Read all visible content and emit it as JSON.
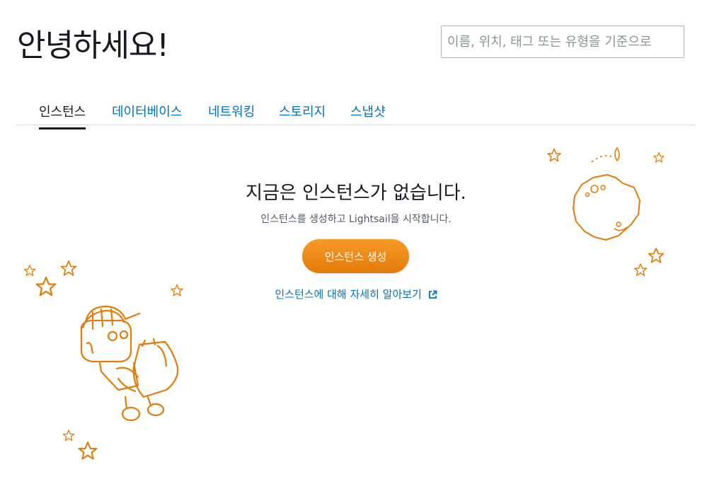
{
  "header": {
    "greeting": "안녕하세요!",
    "search_placeholder": "이름, 위치, 태그 또는 유형을 기준으로"
  },
  "tabs": [
    {
      "label": "인스턴스",
      "active": true
    },
    {
      "label": "데이터베이스",
      "active": false
    },
    {
      "label": "네트워킹",
      "active": false
    },
    {
      "label": "스토리지",
      "active": false
    },
    {
      "label": "스냅샷",
      "active": false
    }
  ],
  "empty_state": {
    "title": "지금은 인스턴스가 없습니다.",
    "subtitle": "인스턴스를 생성하고 Lightsail을 시작합니다.",
    "create_button": "인스턴스 생성",
    "learn_more": "인스턴스에 대해 자세히 알아보기",
    "learn_more_icon": "external-link-icon"
  },
  "illustration": {
    "robot": "robot-astronaut-icon",
    "planet": "planet-icon",
    "stars": "star-icon",
    "color": "#e57b08"
  },
  "colors": {
    "accent": "#e57b08",
    "link": "#0073bb",
    "text": "#16191f"
  }
}
